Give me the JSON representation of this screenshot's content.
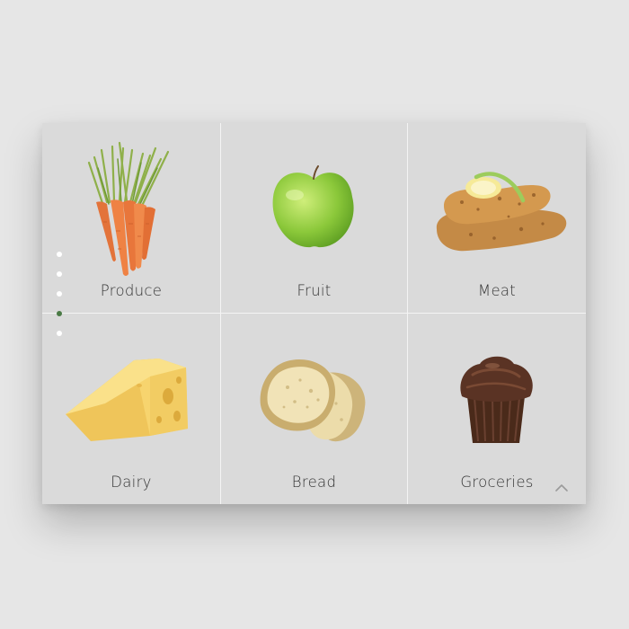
{
  "categories": [
    {
      "label": "Produce",
      "icon": "carrots-icon"
    },
    {
      "label": "Fruit",
      "icon": "green-apple-icon"
    },
    {
      "label": "Meat",
      "icon": "chicken-cutlet-icon"
    },
    {
      "label": "Dairy",
      "icon": "cheese-wedge-icon"
    },
    {
      "label": "Bread",
      "icon": "bread-slices-icon"
    },
    {
      "label": "Groceries",
      "icon": "cupcake-icon"
    }
  ],
  "pagination": {
    "count": 5,
    "active_index": 3
  },
  "colors": {
    "active_dot": "#4a7a45",
    "inactive_dot": "#ffffff"
  },
  "controls": {
    "scroll_top_icon": "chevron-up-icon"
  }
}
